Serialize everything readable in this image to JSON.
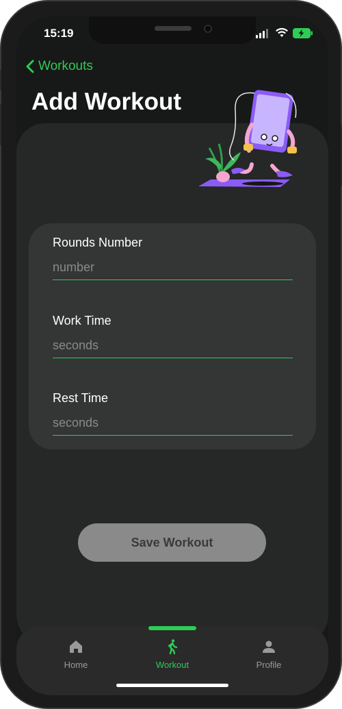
{
  "status_bar": {
    "time": "15:19"
  },
  "nav": {
    "back_label": "Workouts"
  },
  "page": {
    "title": "Add Workout"
  },
  "form": {
    "fields": [
      {
        "label": "Rounds Number",
        "placeholder": "number"
      },
      {
        "label": "Work Time",
        "placeholder": "seconds"
      },
      {
        "label": "Rest Time",
        "placeholder": "seconds"
      }
    ]
  },
  "actions": {
    "save_label": "Save Workout"
  },
  "tabbar": {
    "tabs": [
      {
        "label": "Home",
        "icon": "home-icon"
      },
      {
        "label": "Workout",
        "icon": "walking-icon"
      },
      {
        "label": "Profile",
        "icon": "person-icon"
      }
    ],
    "active": "Workout"
  },
  "colors": {
    "accent": "#2ecc55",
    "background": "#171818",
    "card": "#262727",
    "form_card": "#343535",
    "button": "#8a8a8a"
  }
}
